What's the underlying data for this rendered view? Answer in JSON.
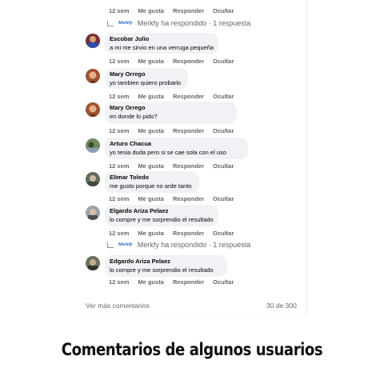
{
  "actions": {
    "time": "12 sem",
    "like": "Me gusta",
    "reply": "Responder",
    "hide": "Ocultar"
  },
  "reply_ref": {
    "brand": "Merkfy",
    "text": "Merkfy ha respondido · 1 respuesta"
  },
  "comments": [
    {
      "name": "Escobar Julio",
      "text": "a mi me sirvio en una verruga pequeña"
    },
    {
      "name": "Mary Orrego",
      "text": "yo tambien quiero probarlo"
    },
    {
      "name": "Mary Orrego",
      "text": "en donde lo pido?"
    },
    {
      "name": "Arturo Chacua",
      "text": "yo tenia duda pero si se cae sola con el uso"
    },
    {
      "name": "Elimar Toledo",
      "text": "me gusto porque no arde tanto"
    },
    {
      "name": "Elgardo Ariza Pelaez",
      "text": "lo compre y me sorprendio el resultado"
    },
    {
      "name": "Edgardo Ariza Pelaez",
      "text": "lo compre y me sorprendio el resultado"
    }
  ],
  "footer": {
    "more": "Ver más comentarios",
    "count": "30 de 300"
  },
  "caption": "Comentarios de algunos usuarios",
  "icons": {
    "avatar": "user-avatar-icon",
    "reply": "reply-arrow-icon",
    "logo": "merkfy-logo-icon"
  }
}
